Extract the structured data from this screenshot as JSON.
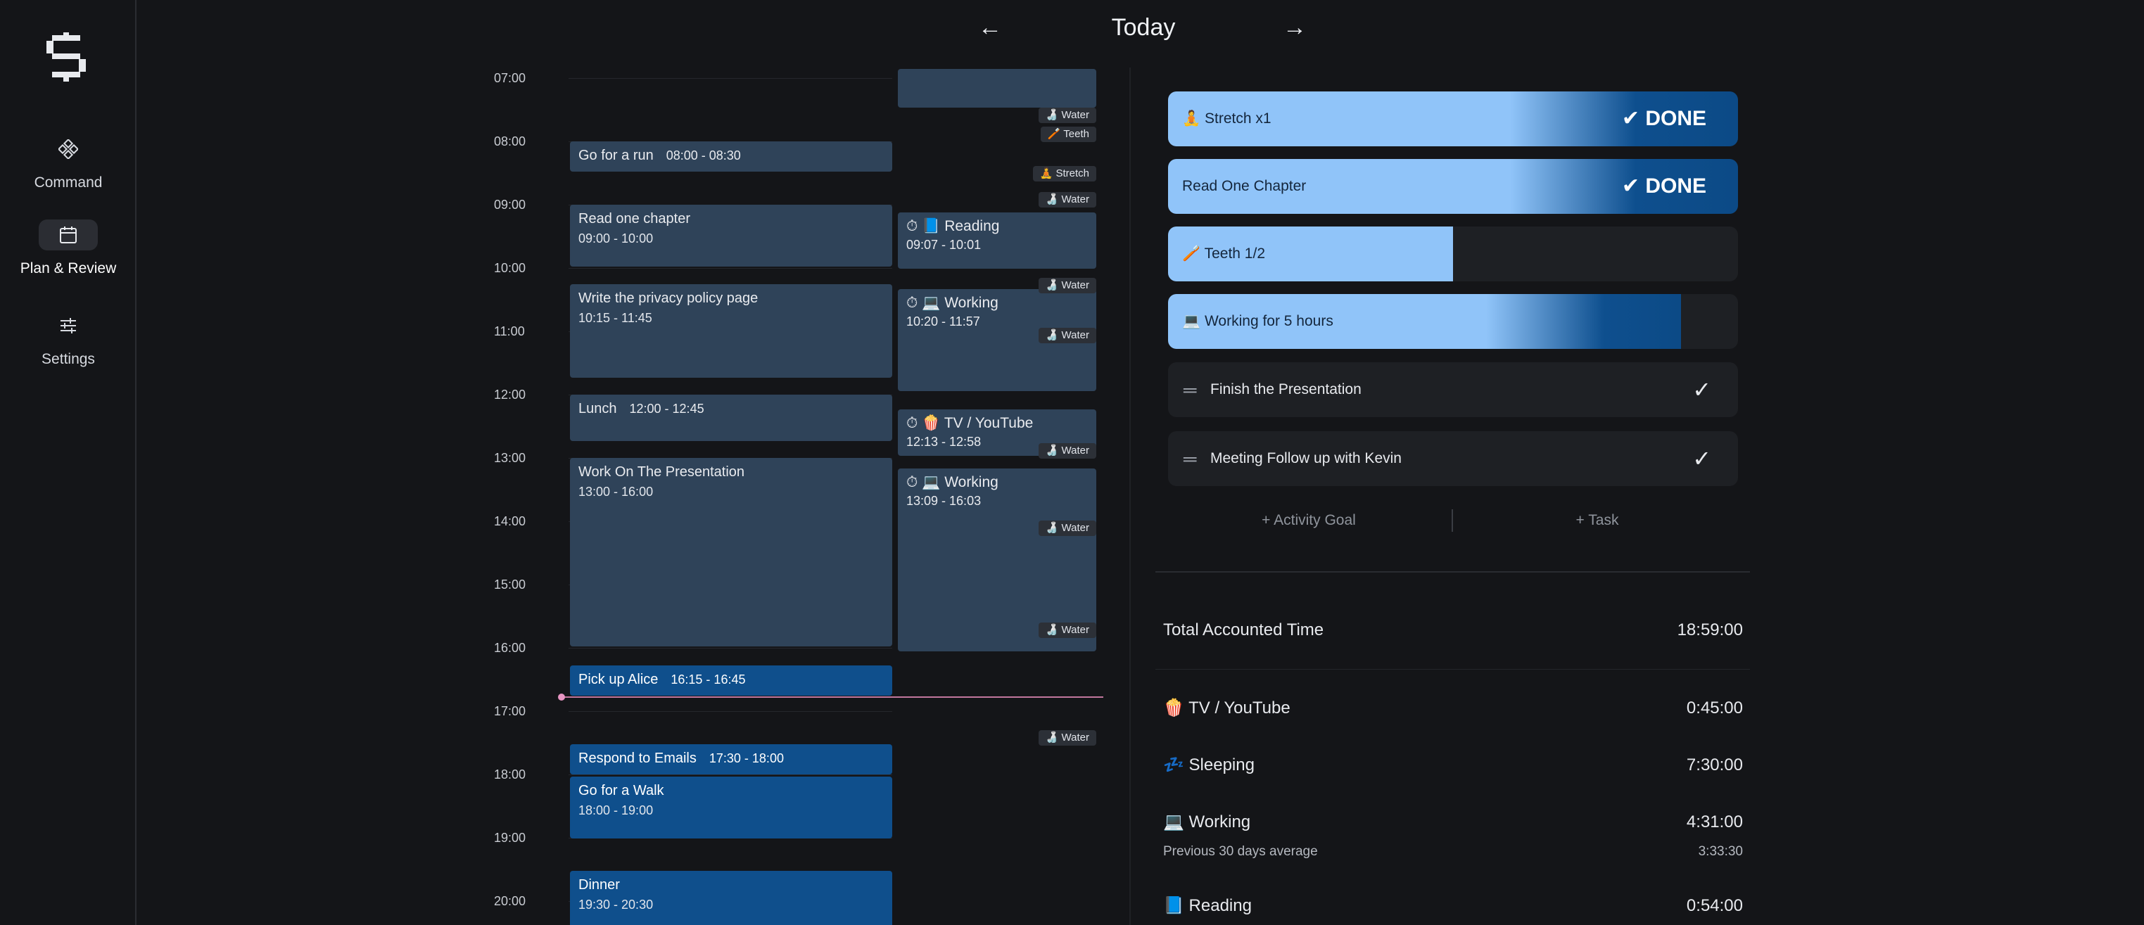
{
  "sidebar": {
    "logo_icon": "s-logo-icon",
    "items": [
      {
        "label": "Command",
        "icon": "command-icon"
      },
      {
        "label": "Plan & Review",
        "icon": "calendar-icon",
        "active": true
      },
      {
        "label": "Settings",
        "icon": "sliders-icon"
      }
    ]
  },
  "header": {
    "title": "Today",
    "prev_icon": "arrow-left-icon",
    "next_icon": "arrow-right-icon",
    "prev_glyph": "←",
    "next_glyph": "→"
  },
  "timeline": {
    "hours": [
      "07:00",
      "08:00",
      "09:00",
      "10:00",
      "11:00",
      "12:00",
      "13:00",
      "14:00",
      "15:00",
      "16:00",
      "17:00",
      "18:00",
      "19:00",
      "20:00"
    ],
    "planned": [
      {
        "title": "Go for a run",
        "time": "08:00 - 08:30"
      },
      {
        "title": "Read one chapter",
        "time": "09:00 - 10:00"
      },
      {
        "title": "Write the privacy policy page",
        "time": "10:15 - 11:45"
      },
      {
        "title": "Lunch",
        "time": "12:00 - 12:45"
      },
      {
        "title": "Work On The Presentation",
        "time": "13:00 - 16:00"
      },
      {
        "title": "Pick up Alice",
        "time": "16:15 - 16:45"
      },
      {
        "title": "Respond to Emails",
        "time": "17:30 - 18:00"
      },
      {
        "title": "Go for a Walk",
        "time": "18:00 - 19:00"
      },
      {
        "title": "Dinner",
        "time": "19:30 - 20:30"
      }
    ],
    "tracked": [
      {
        "title": "⏱ 📘 Reading",
        "time": "09:07 - 10:01"
      },
      {
        "title": "⏱ 💻 Working",
        "time": "10:20 - 11:57"
      },
      {
        "title": "⏱ 🍿 TV / YouTube",
        "time": "12:13 - 12:58"
      },
      {
        "title": "⏱ 💻 Working",
        "time": "13:09 - 16:03"
      }
    ],
    "chips": [
      {
        "label": "🍶 Water"
      },
      {
        "label": "🪥 Teeth"
      },
      {
        "label": "🧘 Stretch"
      },
      {
        "label": "🍶 Water"
      },
      {
        "label": "🍶 Water"
      },
      {
        "label": "🍶 Water"
      },
      {
        "label": "🍶 Water"
      },
      {
        "label": "🍶 Water"
      },
      {
        "label": "🍶 Water"
      },
      {
        "label": "🍶 Water"
      }
    ]
  },
  "goals": [
    {
      "label": "🧘 Stretch x1",
      "done_label": "✔ DONE",
      "progress": 1.0
    },
    {
      "label": "Read One Chapter",
      "done_label": "✔ DONE",
      "progress": 1.0
    },
    {
      "label": "🪥 Teeth 1/2",
      "progress": 0.5
    },
    {
      "label": "💻 Working for 5 hours",
      "progress": 0.9
    }
  ],
  "tasks": [
    {
      "label": "Finish the Presentation",
      "handle": "═",
      "check": "✓"
    },
    {
      "label": "Meeting Follow up with Kevin",
      "handle": "═",
      "check": "✓"
    }
  ],
  "add_buttons": {
    "activity_goal": "+ Activity Goal",
    "task": "+ Task"
  },
  "stats": {
    "total_label": "Total Accounted Time",
    "total_value": "18:59:00",
    "rows": [
      {
        "label": "🍿 TV / YouTube",
        "value": "0:45:00"
      },
      {
        "label": "💤 Sleeping",
        "value": "7:30:00"
      },
      {
        "label": "💻 Working",
        "value": "4:31:00",
        "sub_label": "Previous 30 days average",
        "sub_value": "3:33:30"
      },
      {
        "label": "📘 Reading",
        "value": "0:54:00"
      }
    ]
  },
  "colors": {
    "background": "#141518",
    "planned_event": "#2f4359",
    "upcoming_event": "#0f4f8c",
    "goal_fill": "#90c4f9",
    "goal_done": "#0c4a86",
    "now_line": "#c2779e"
  }
}
